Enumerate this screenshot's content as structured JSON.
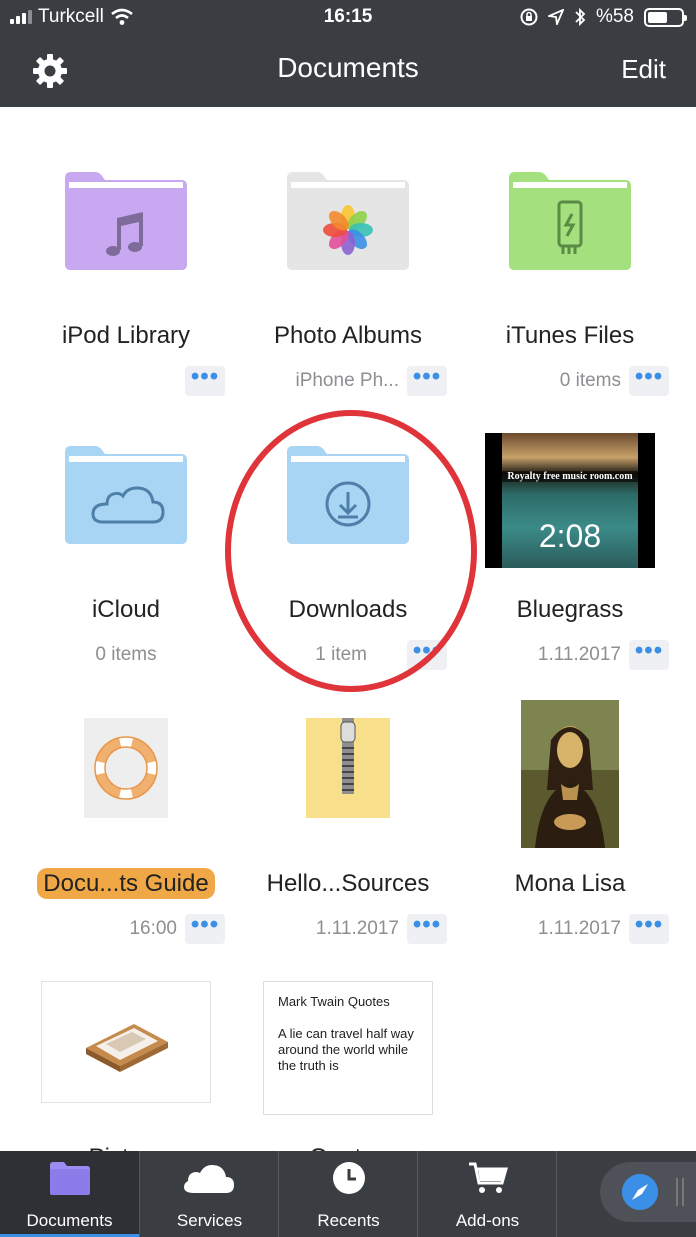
{
  "status_bar": {
    "carrier": "Turkcell",
    "time": "16:15",
    "battery": "%58",
    "battery_level": 0.58
  },
  "nav": {
    "title": "Documents",
    "edit_label": "Edit"
  },
  "items": [
    {
      "name": "iPod Library",
      "sub": "",
      "more": "•••",
      "folder_color": "#c9a8f2",
      "icon": "music-note-icon"
    },
    {
      "name": "Photo Albums",
      "sub": "iPhone Ph...",
      "more": "•••",
      "folder_color": "#e5e5e5",
      "icon": "photos-icon"
    },
    {
      "name": "iTunes Files",
      "sub": "0 items",
      "more": "•••",
      "folder_color": "#a4e07e",
      "icon": "usb-icon"
    },
    {
      "name": "iCloud",
      "sub": "0 items",
      "more": "",
      "folder_color": "#a9d5f5",
      "icon": "cloud-icon"
    },
    {
      "name": "Downloads",
      "sub": "1 item",
      "more": "•••",
      "folder_color": "#a9d5f5",
      "icon": "download-icon"
    },
    {
      "name": "Bluegrass",
      "sub": "1.11.2017",
      "more": "•••",
      "video_duration": "2:08",
      "video_caption": "Royalty free music room.com",
      "icon": "video-thumbnail"
    },
    {
      "name": "Docu...ts Guide",
      "sub": "16:00",
      "more": "•••",
      "icon": "lifebuoy-icon"
    },
    {
      "name": "Hello...Sources",
      "sub": "1.11.2017",
      "more": "•••",
      "icon": "zip-icon"
    },
    {
      "name": "Mona Lisa",
      "sub": "1.11.2017",
      "more": "•••",
      "icon": "painting-thumbnail"
    },
    {
      "name": "Picture",
      "sub": "",
      "more": "",
      "icon": "picture-tray-icon"
    },
    {
      "name": "Quotes",
      "sub": "",
      "more": "",
      "doc_title": "Mark Twain Quotes",
      "doc_body": "A lie can travel half way around the world while the truth is",
      "icon": "text-doc-thumbnail"
    }
  ],
  "tabs": [
    {
      "label": "Documents",
      "icon": "folder-icon",
      "active": true
    },
    {
      "label": "Services",
      "icon": "cloud-icon"
    },
    {
      "label": "Recents",
      "icon": "clock-icon"
    },
    {
      "label": "Add-ons",
      "icon": "cart-icon"
    }
  ],
  "colors": {
    "bar": "#3a3d42",
    "accent": "#3b8fe6",
    "annotation": "#e0343b"
  }
}
